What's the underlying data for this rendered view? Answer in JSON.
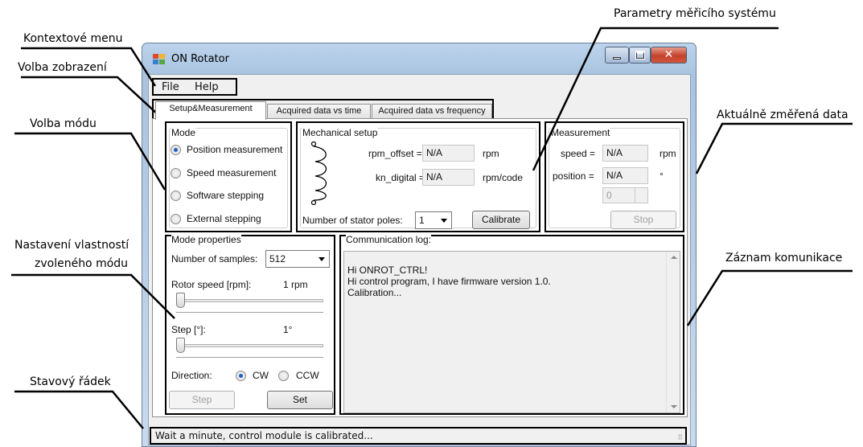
{
  "annotations": {
    "kontext": "Kontextové menu",
    "volba_zobrazeni": "Volba zobrazení",
    "volba_modu": "Volba módu",
    "nastaveni_1": "Nastavení vlastností",
    "nastaveni_2": "zvoleného módu",
    "stavovy": "Stavový řádek",
    "parametry": "Parametry měřicího systému",
    "aktualne": "Aktuálně změřená data",
    "zaznam": "Záznam komunikace"
  },
  "window": {
    "title": "ON Rotator"
  },
  "menu": {
    "file": "File",
    "help": "Help"
  },
  "tabs": [
    "Setup&Measurement",
    "Acquired data vs time",
    "Acquired data vs frequency"
  ],
  "mode": {
    "title": "Mode",
    "options": [
      "Position measurement",
      "Speed measurement",
      "Software stepping",
      "External stepping"
    ],
    "selected": 0
  },
  "mechanical": {
    "title": "Mechanical setup",
    "rpm_offset_label": "rpm_offset =",
    "rpm_offset_value": "N/A",
    "rpm_offset_unit": "rpm",
    "kn_digital_label": "kn_digital =",
    "kn_digital_value": "N/A",
    "kn_digital_unit": "rpm/code",
    "poles_label": "Number of stator poles:",
    "poles_value": "1",
    "calibrate": "Calibrate"
  },
  "measurement": {
    "title": "Measurement",
    "speed_label": "speed =",
    "speed_value": "N/A",
    "speed_unit": "rpm",
    "position_label": "position =",
    "position_value": "N/A",
    "position_unit": "°",
    "spin_value": "0",
    "stop": "Stop"
  },
  "props": {
    "title": "Mode properties",
    "samples_label": "Number of samples:",
    "samples_value": "512",
    "rotor_label": "Rotor speed [rpm]:",
    "rotor_value": "1 rpm",
    "step_label": "Step [°]:",
    "step_value": "1°",
    "direction_label": "Direction:",
    "cw": "CW",
    "ccw": "CCW",
    "step_btn": "Step",
    "set_btn": "Set"
  },
  "log": {
    "title": "Communication log:",
    "lines": [
      "Hi ONROT_CTRL!",
      "Hi control program, I have firmware version 1.0.",
      "Calibration..."
    ]
  },
  "status": {
    "text": "Wait a minute, control module is calibrated..."
  }
}
